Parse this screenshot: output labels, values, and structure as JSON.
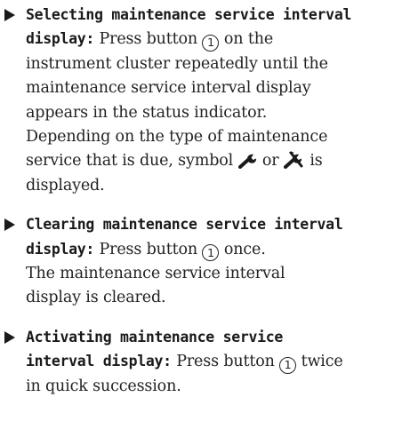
{
  "items": [
    {
      "heading": "Selecting maintenance service interval",
      "heading_cont": "display:",
      "l1_rest": " Press button ",
      "button_num": "1",
      "l2_tail": " on the",
      "line3": "instrument cluster repeatedly until the",
      "line4": "maintenance service interval display",
      "line5": "appears in the status indicator.",
      "line6": "Depending on the type of maintenance",
      "line7a": "service that is due, symbol ",
      "line7b": " or ",
      "line7c": " is",
      "line8": "displayed."
    },
    {
      "heading": "Clearing maintenance service interval",
      "heading_cont": "display:",
      "l1_rest": " Press button ",
      "button_num": "1",
      "l2_tail": " once.",
      "line3": "The maintenance service interval",
      "line4": "display is cleared."
    },
    {
      "heading": "Activating maintenance service",
      "heading_cont": "interval display:",
      "l1_rest": " Press button ",
      "button_num": "1",
      "l2_tail": " twice",
      "line3": "in quick succession."
    }
  ],
  "icons": [
    "wrench-icon",
    "double-wrench-icon"
  ]
}
